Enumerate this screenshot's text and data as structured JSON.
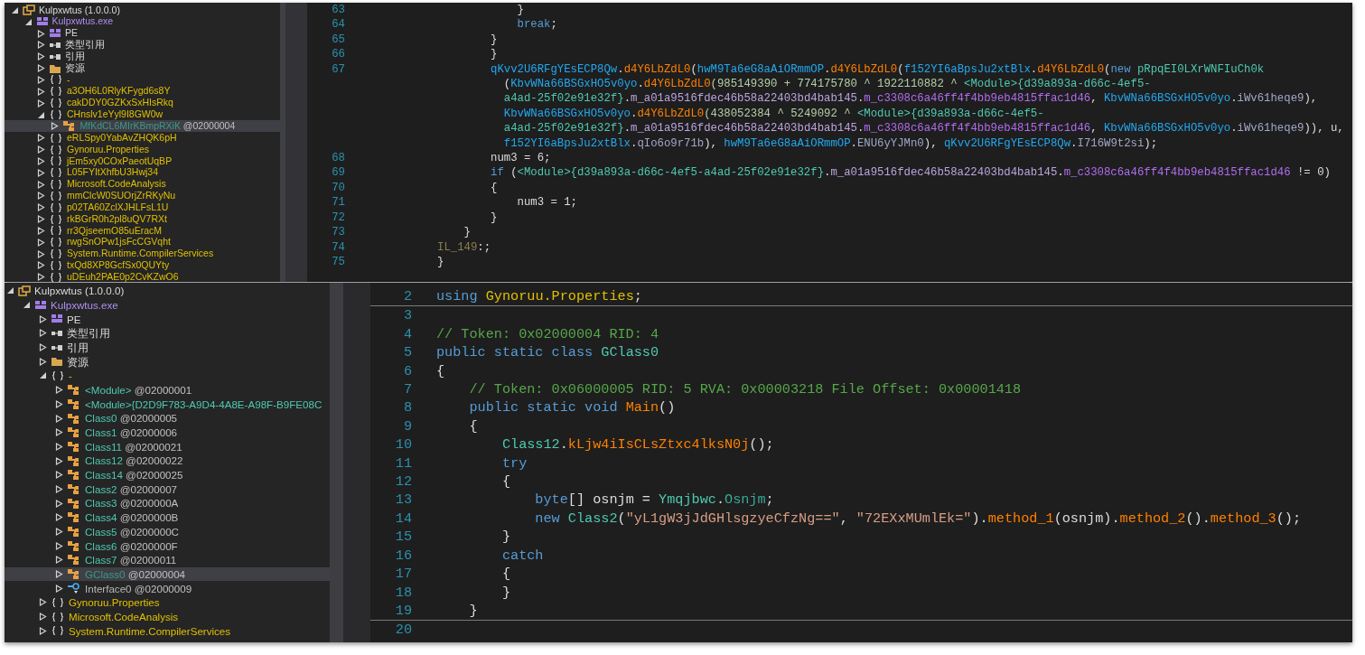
{
  "panels": [
    {
      "kind": "compact",
      "tree": [
        {
          "label": "Kulpxwtus (1.0.0.0)",
          "kind": "assembly",
          "expanded": true,
          "selected": false,
          "children": [
            {
              "label": "Kulpxwtus.exe",
              "kind": "module",
              "expanded": true,
              "selected": false,
              "children": [
                {
                  "label": "PE",
                  "kind": "pe",
                  "expanded": false,
                  "selected": false
                },
                {
                  "label": "类型引用",
                  "kind": "refs",
                  "expanded": false,
                  "selected": false
                },
                {
                  "label": "引用",
                  "kind": "refs",
                  "expanded": false,
                  "selected": false
                },
                {
                  "label": "资源",
                  "kind": "folder",
                  "expanded": false,
                  "selected": false
                },
                {
                  "label": "-",
                  "kind": "namespace",
                  "expanded": false,
                  "selected": false
                },
                {
                  "label": "a3OH6L0RlyKFygd6s8Y",
                  "kind": "namespace",
                  "expanded": false,
                  "selected": false
                },
                {
                  "label": "cakDDY0GZKxSxHIsRkq",
                  "kind": "namespace",
                  "expanded": false,
                  "selected": false
                },
                {
                  "label": "CHnslv1eYyl9I8GW0w",
                  "kind": "namespace",
                  "expanded": true,
                  "selected": false,
                  "children": [
                    {
                      "label": "MfKdCL6MIrKBmpRXiK",
                      "token": "@02000004",
                      "kind": "class",
                      "expanded": false,
                      "selected": true
                    }
                  ]
                },
                {
                  "label": "eRLSpy0YabAvZHQK6pH",
                  "kind": "namespace",
                  "expanded": false,
                  "selected": false
                },
                {
                  "label": "Gynoruu.Properties",
                  "kind": "namespace",
                  "expanded": false,
                  "selected": false
                },
                {
                  "label": "jEm5xy0COxPaeotUqBP",
                  "kind": "namespace",
                  "expanded": false,
                  "selected": false
                },
                {
                  "label": "L05FYItXhfbU3Hwj34",
                  "kind": "namespace",
                  "expanded": false,
                  "selected": false
                },
                {
                  "label": "Microsoft.CodeAnalysis",
                  "kind": "namespace",
                  "expanded": false,
                  "selected": false
                },
                {
                  "label": "mmClcW0SUOrjZrRKyNu",
                  "kind": "namespace",
                  "expanded": false,
                  "selected": false
                },
                {
                  "label": "p02TA60ZclXJHLFsL1U",
                  "kind": "namespace",
                  "expanded": false,
                  "selected": false
                },
                {
                  "label": "rkBGrR0h2pl8uQV7RXt",
                  "kind": "namespace",
                  "expanded": false,
                  "selected": false
                },
                {
                  "label": "rr3QjseemO85uEracM",
                  "kind": "namespace",
                  "expanded": false,
                  "selected": false
                },
                {
                  "label": "rwgSnOPw1jsFcCGVqht",
                  "kind": "namespace",
                  "expanded": false,
                  "selected": false
                },
                {
                  "label": "System.Runtime.CompilerServices",
                  "kind": "namespace",
                  "expanded": false,
                  "selected": false
                },
                {
                  "label": "txQd8XP8GcfSx0QUYty",
                  "kind": "namespace",
                  "expanded": false,
                  "selected": false
                },
                {
                  "label": "uDEuh2PAE0p2CvKZwO6",
                  "kind": "namespace",
                  "expanded": false,
                  "selected": false
                }
              ]
            }
          ]
        }
      ],
      "code": [
        {
          "number": "63",
          "tokens": [
            {
              "t": "            }",
              "kind": "plain"
            }
          ]
        },
        {
          "number": "64",
          "tokens": [
            {
              "t": "            break",
              "kind": "kw"
            },
            {
              "t": ";",
              "kind": "plain"
            }
          ]
        },
        {
          "number": "65",
          "tokens": [
            {
              "t": "        }",
              "kind": "plain"
            }
          ]
        },
        {
          "number": "66",
          "tokens": [
            {
              "t": "        }",
              "kind": "plain"
            }
          ]
        },
        {
          "number": "67",
          "tokens": [
            {
              "t": "        qKvv2U6RFgYEsECP8Qw",
              "kind": "cls"
            },
            {
              "t": ".",
              "kind": "plain"
            },
            {
              "t": "d4Y6LbZdL0",
              "kind": "method"
            },
            {
              "t": "(",
              "kind": "plain"
            },
            {
              "t": "hwM9Ta6eG8aAiORmmOP",
              "kind": "cls"
            },
            {
              "t": ".",
              "kind": "plain"
            },
            {
              "t": "d4Y6LbZdL0",
              "kind": "method"
            },
            {
              "t": "(",
              "kind": "plain"
            },
            {
              "t": "f152YI6aBpsJu2xtBlx",
              "kind": "cls"
            },
            {
              "t": ".",
              "kind": "plain"
            },
            {
              "t": "d4Y6LbZdL0",
              "kind": "method"
            },
            {
              "t": "(",
              "kind": "plain"
            },
            {
              "t": "new",
              "kind": "kw"
            },
            {
              "t": " pRpqEI0LXrWNFIuCh0k",
              "kind": "type"
            }
          ]
        },
        {
          "tokens": [
            {
              "t": "          (",
              "kind": "plain"
            },
            {
              "t": "KbvWNa66BSGxHO5v0yo",
              "kind": "cls"
            },
            {
              "t": ".",
              "kind": "plain"
            },
            {
              "t": "d4Y6LbZdL0",
              "kind": "method"
            },
            {
              "t": "(985149390 + 774175780 ^ 1922110882 ^ ",
              "kind": "num"
            },
            {
              "t": "<Module>{d39a893a-d66c-4ef5-",
              "kind": "type"
            }
          ]
        },
        {
          "tokens": [
            {
              "t": "          a4ad-25f02e91e32f}",
              "kind": "type"
            },
            {
              "t": ".",
              "kind": "plain"
            },
            {
              "t": "m_a01a9516fdec46b58a22403bd4bab145",
              "kind": "member"
            },
            {
              "t": ".",
              "kind": "plain"
            },
            {
              "t": "m_c3308c6a46ff4f4bb9eb4815ffac1d46",
              "kind": "field"
            },
            {
              "t": ", ",
              "kind": "plain"
            },
            {
              "t": "KbvWNa66BSGxHO5v0yo",
              "kind": "cls"
            },
            {
              "t": ".",
              "kind": "plain"
            },
            {
              "t": "iWv61heqe9",
              "kind": "prop"
            },
            {
              "t": "),",
              "kind": "plain"
            }
          ]
        },
        {
          "tokens": [
            {
              "t": "          KbvWNa66BSGxHO5v0yo",
              "kind": "cls"
            },
            {
              "t": ".",
              "kind": "plain"
            },
            {
              "t": "d4Y6LbZdL0",
              "kind": "method"
            },
            {
              "t": "(438052384 ^ 5249092 ^ ",
              "kind": "num"
            },
            {
              "t": "<Module>{d39a893a-d66c-4ef5-",
              "kind": "type"
            }
          ]
        },
        {
          "tokens": [
            {
              "t": "          a4ad-25f02e91e32f}",
              "kind": "type"
            },
            {
              "t": ".",
              "kind": "plain"
            },
            {
              "t": "m_a01a9516fdec46b58a22403bd4bab145",
              "kind": "member"
            },
            {
              "t": ".",
              "kind": "plain"
            },
            {
              "t": "m_c3308c6a46ff4f4bb9eb4815ffac1d46",
              "kind": "field"
            },
            {
              "t": ", ",
              "kind": "plain"
            },
            {
              "t": "KbvWNa66BSGxHO5v0yo",
              "kind": "cls"
            },
            {
              "t": ".",
              "kind": "plain"
            },
            {
              "t": "iWv61heqe9",
              "kind": "prop"
            },
            {
              "t": ")), u,",
              "kind": "plain"
            }
          ]
        },
        {
          "tokens": [
            {
              "t": "          f152YI6aBpsJu2xtBlx",
              "kind": "cls"
            },
            {
              "t": ".",
              "kind": "plain"
            },
            {
              "t": "qIo6o9r71b",
              "kind": "prop"
            },
            {
              "t": "), ",
              "kind": "plain"
            },
            {
              "t": "hwM9Ta6eG8aAiORmmOP",
              "kind": "cls"
            },
            {
              "t": ".",
              "kind": "plain"
            },
            {
              "t": "ENU6yYJMn0",
              "kind": "prop"
            },
            {
              "t": "), ",
              "kind": "plain"
            },
            {
              "t": "qKvv2U6RFgYEsECP8Qw",
              "kind": "cls"
            },
            {
              "t": ".",
              "kind": "plain"
            },
            {
              "t": "I716W9t2si",
              "kind": "prop"
            },
            {
              "t": ");",
              "kind": "plain"
            }
          ]
        },
        {
          "number": "68",
          "tokens": [
            {
              "t": "        num3 = 6;",
              "kind": "plain"
            }
          ]
        },
        {
          "number": "69",
          "tokens": [
            {
              "t": "        if",
              "kind": "kw"
            },
            {
              "t": " (",
              "kind": "plain"
            },
            {
              "t": "<Module>{d39a893a-d66c-4ef5-a4ad-25f02e91e32f}",
              "kind": "type"
            },
            {
              "t": ".",
              "kind": "plain"
            },
            {
              "t": "m_a01a9516fdec46b58a22403bd4bab145",
              "kind": "member"
            },
            {
              "t": ".",
              "kind": "plain"
            },
            {
              "t": "m_c3308c6a46ff4f4bb9eb4815ffac1d46",
              "kind": "field"
            },
            {
              "t": " != 0)",
              "kind": "plain"
            }
          ]
        },
        {
          "number": "70",
          "tokens": [
            {
              "t": "        {",
              "kind": "plain"
            }
          ]
        },
        {
          "number": "71",
          "tokens": [
            {
              "t": "            num3 = 1;",
              "kind": "plain"
            }
          ]
        },
        {
          "number": "72",
          "tokens": [
            {
              "t": "        }",
              "kind": "plain"
            }
          ]
        },
        {
          "number": "73",
          "tokens": [
            {
              "t": "    }",
              "kind": "plain"
            }
          ]
        },
        {
          "number": "74",
          "tokens": [
            {
              "t": "IL_149",
              "kind": "label"
            },
            {
              "t": ":;",
              "kind": "plain"
            }
          ]
        },
        {
          "number": "75",
          "tokens": [
            {
              "t": "}",
              "kind": "plain"
            }
          ]
        }
      ]
    },
    {
      "kind": "wide",
      "tree": [
        {
          "label": "Kulpxwtus (1.0.0.0)",
          "kind": "assembly",
          "expanded": true,
          "selected": false,
          "children": [
            {
              "label": "Kulpxwtus.exe",
              "kind": "module",
              "expanded": true,
              "selected": false,
              "children": [
                {
                  "label": "PE",
                  "kind": "pe",
                  "expanded": false,
                  "selected": false
                },
                {
                  "label": "类型引用",
                  "kind": "refs",
                  "expanded": false,
                  "selected": false
                },
                {
                  "label": "引用",
                  "kind": "refs",
                  "expanded": false,
                  "selected": false
                },
                {
                  "label": "资源",
                  "kind": "folder",
                  "expanded": false,
                  "selected": false
                },
                {
                  "label": "-",
                  "kind": "namespace",
                  "expanded": true,
                  "selected": false,
                  "children": [
                    {
                      "label": "<Module>",
                      "token": "@02000001",
                      "kind": "class",
                      "expanded": false,
                      "selected": false
                    },
                    {
                      "label": "<Module>{D2D9F783-A9D4-4A8E-A98F-B9FE08C",
                      "kind": "class",
                      "expanded": false,
                      "selected": false
                    },
                    {
                      "label": "Class0",
                      "token": "@02000005",
                      "kind": "class",
                      "expanded": false,
                      "selected": false
                    },
                    {
                      "label": "Class1",
                      "token": "@02000006",
                      "kind": "class",
                      "expanded": false,
                      "selected": false
                    },
                    {
                      "label": "Class11",
                      "token": "@02000021",
                      "kind": "class",
                      "expanded": false,
                      "selected": false
                    },
                    {
                      "label": "Class12",
                      "token": "@02000022",
                      "kind": "class",
                      "expanded": false,
                      "selected": false
                    },
                    {
                      "label": "Class14",
                      "token": "@02000025",
                      "kind": "class",
                      "expanded": false,
                      "selected": false
                    },
                    {
                      "label": "Class2",
                      "token": "@02000007",
                      "kind": "class",
                      "expanded": false,
                      "selected": false
                    },
                    {
                      "label": "Class3",
                      "token": "@0200000A",
                      "kind": "class",
                      "expanded": false,
                      "selected": false
                    },
                    {
                      "label": "Class4",
                      "token": "@0200000B",
                      "kind": "class",
                      "expanded": false,
                      "selected": false
                    },
                    {
                      "label": "Class5",
                      "token": "@0200000C",
                      "kind": "class",
                      "expanded": false,
                      "selected": false
                    },
                    {
                      "label": "Class6",
                      "token": "@0200000F",
                      "kind": "class",
                      "expanded": false,
                      "selected": false
                    },
                    {
                      "label": "Class7",
                      "token": "@02000011",
                      "kind": "class",
                      "expanded": false,
                      "selected": false
                    },
                    {
                      "label": "GClass0",
                      "token": "@02000004",
                      "kind": "class",
                      "expanded": false,
                      "selected": true
                    },
                    {
                      "label": "Interface0",
                      "token": "@02000009",
                      "kind": "interface",
                      "expanded": false,
                      "selected": false
                    }
                  ]
                },
                {
                  "label": "Gynoruu.Properties",
                  "kind": "namespace",
                  "expanded": false,
                  "selected": false
                },
                {
                  "label": "Microsoft.CodeAnalysis",
                  "kind": "namespace",
                  "expanded": false,
                  "selected": false
                },
                {
                  "label": "System.Runtime.CompilerServices",
                  "kind": "namespace",
                  "expanded": false,
                  "selected": false
                }
              ]
            }
          ]
        }
      ],
      "code": [
        {
          "number": "2",
          "separator_below": true,
          "tokens": [
            {
              "t": "using",
              "kind": "kw"
            },
            {
              "t": " Gynoruu.Properties",
              "kind": "ns"
            },
            {
              "t": ";",
              "kind": "plain"
            }
          ]
        },
        {
          "number": "3"
        },
        {
          "number": "4",
          "tokens": [
            {
              "t": "// Token: 0x02000004 RID: 4",
              "kind": "comment"
            }
          ]
        },
        {
          "number": "5",
          "tokens": [
            {
              "t": "public static class",
              "kind": "kw"
            },
            {
              "t": " GClass0",
              "kind": "type"
            }
          ]
        },
        {
          "number": "6",
          "tokens": [
            {
              "t": "{",
              "kind": "plain"
            }
          ]
        },
        {
          "number": "7",
          "tokens": [
            {
              "t": "    // Token: 0x06000005 RID: 5 RVA: 0x00003218 File Offset: 0x00001418",
              "kind": "comment"
            }
          ]
        },
        {
          "number": "8",
          "tokens": [
            {
              "t": "    public static void",
              "kind": "kw"
            },
            {
              "t": " Main",
              "kind": "method"
            },
            {
              "t": "()",
              "kind": "plain"
            }
          ]
        },
        {
          "number": "9",
          "tokens": [
            {
              "t": "    {",
              "kind": "plain"
            }
          ]
        },
        {
          "number": "10",
          "tokens": [
            {
              "t": "        Class12",
              "kind": "type"
            },
            {
              "t": ".",
              "kind": "plain"
            },
            {
              "t": "kLjw4iIsCLsZtxc4lksN0j",
              "kind": "method"
            },
            {
              "t": "();",
              "kind": "plain"
            }
          ]
        },
        {
          "number": "11",
          "tokens": [
            {
              "t": "        try",
              "kind": "kw"
            }
          ]
        },
        {
          "number": "12",
          "tokens": [
            {
              "t": "        {",
              "kind": "plain"
            }
          ]
        },
        {
          "number": "13",
          "tokens": [
            {
              "t": "            byte",
              "kind": "kw"
            },
            {
              "t": "[] osnjm = ",
              "kind": "plain"
            },
            {
              "t": "Ymqjbwc",
              "kind": "type"
            },
            {
              "t": ".",
              "kind": "plain"
            },
            {
              "t": "Osnjm",
              "kind": "sfield"
            },
            {
              "t": ";",
              "kind": "plain"
            }
          ]
        },
        {
          "number": "14",
          "tokens": [
            {
              "t": "            new",
              "kind": "kw"
            },
            {
              "t": " Class2",
              "kind": "type"
            },
            {
              "t": "(",
              "kind": "plain"
            },
            {
              "t": "\"yL1gW3jJdGHlsgzyeCfzNg==\"",
              "kind": "string"
            },
            {
              "t": ", ",
              "kind": "plain"
            },
            {
              "t": "\"72EXxMUmlEk=\"",
              "kind": "string"
            },
            {
              "t": ").",
              "kind": "plain"
            },
            {
              "t": "method_1",
              "kind": "method"
            },
            {
              "t": "(osnjm).",
              "kind": "plain"
            },
            {
              "t": "method_2",
              "kind": "method"
            },
            {
              "t": "().",
              "kind": "plain"
            },
            {
              "t": "method_3",
              "kind": "method"
            },
            {
              "t": "();",
              "kind": "plain"
            }
          ]
        },
        {
          "number": "15",
          "tokens": [
            {
              "t": "        }",
              "kind": "plain"
            }
          ]
        },
        {
          "number": "16",
          "tokens": [
            {
              "t": "        catch",
              "kind": "kw"
            }
          ]
        },
        {
          "number": "17",
          "tokens": [
            {
              "t": "        {",
              "kind": "plain"
            }
          ]
        },
        {
          "number": "18",
          "tokens": [
            {
              "t": "        }",
              "kind": "plain"
            }
          ]
        },
        {
          "number": "19",
          "separator_below": true,
          "tokens": [
            {
              "t": "    }",
              "kind": "plain"
            }
          ]
        },
        {
          "number": "20"
        }
      ]
    }
  ]
}
